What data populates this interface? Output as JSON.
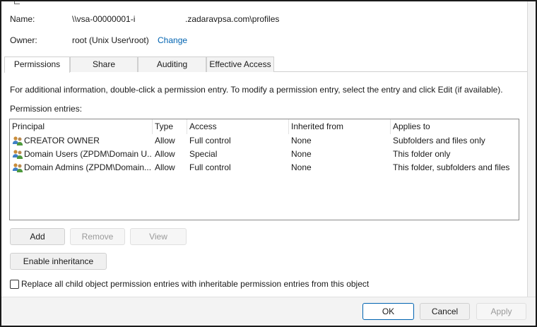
{
  "header": {
    "name_label": "Name:",
    "name_prefix": "\\\\vsa-00000001-i",
    "name_suffix": ".zadaravpsa.com\\profiles",
    "owner_label": "Owner:",
    "owner_value": "root (Unix User\\root)",
    "change_link": "Change"
  },
  "tabs": [
    {
      "label": "Permissions",
      "active": true
    },
    {
      "label": "Share",
      "active": false
    },
    {
      "label": "Auditing",
      "active": false
    },
    {
      "label": "Effective Access",
      "active": false
    }
  ],
  "info_text": "For additional information, double-click a permission entry. To modify a permission entry, select the entry and click Edit (if available).",
  "entries_label": "Permission entries:",
  "table": {
    "columns": [
      "Principal",
      "Type",
      "Access",
      "Inherited from",
      "Applies to"
    ],
    "rows": [
      {
        "icon": "users-group-icon",
        "principal": "CREATOR OWNER",
        "type": "Allow",
        "access": "Full control",
        "inherited": "None",
        "applies": "Subfolders and files only"
      },
      {
        "icon": "users-group-icon",
        "principal": "Domain Users (ZPDM\\Domain U...",
        "type": "Allow",
        "access": "Special",
        "inherited": "None",
        "applies": "This folder only"
      },
      {
        "icon": "users-group-icon",
        "principal": "Domain Admins (ZPDM\\Domain...",
        "type": "Allow",
        "access": "Full control",
        "inherited": "None",
        "applies": "This folder, subfolders and files"
      }
    ]
  },
  "buttons": {
    "add": "Add",
    "remove": "Remove",
    "view": "View",
    "enable_inheritance": "Enable inheritance"
  },
  "replace_checkbox": {
    "label": "Replace all child object permission entries with inheritable permission entries from this object",
    "checked": false
  },
  "footer": {
    "ok": "OK",
    "cancel": "Cancel",
    "apply": "Apply"
  },
  "colors": {
    "link": "#0063b1",
    "accent_border": "#0063b1",
    "disabled_text": "#9a9a9a"
  }
}
